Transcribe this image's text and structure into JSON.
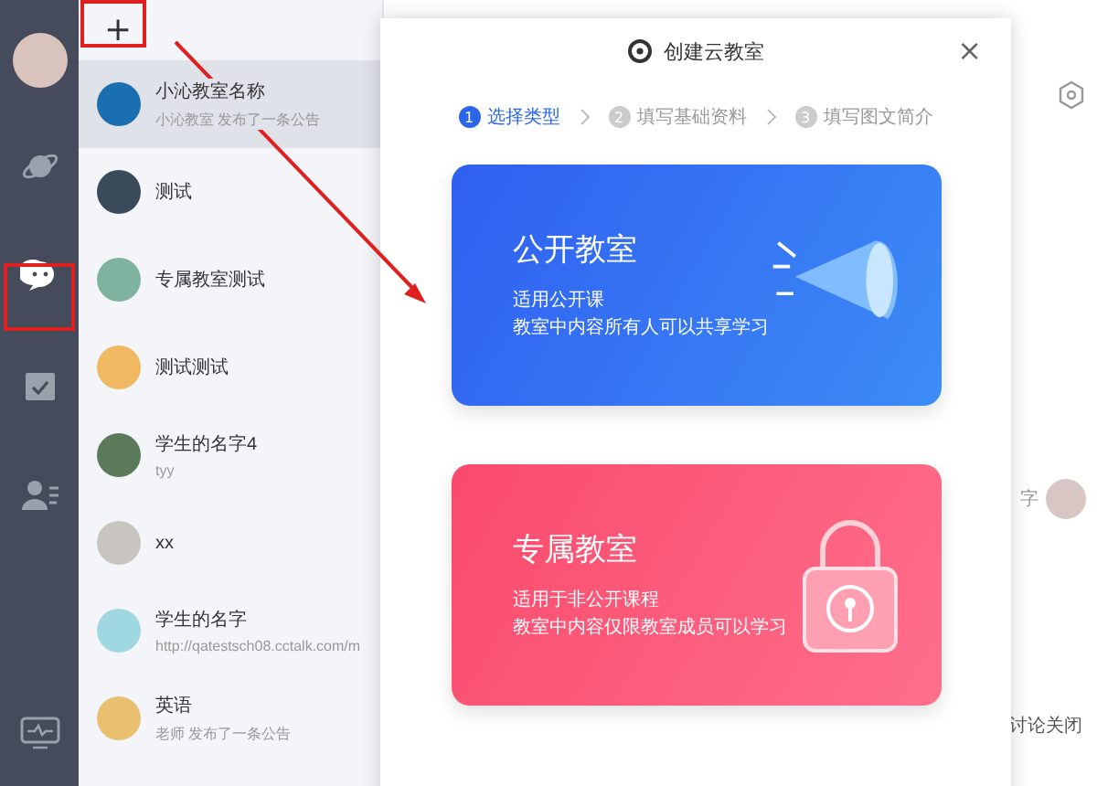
{
  "rail": {
    "items": [
      {
        "kind": "planet",
        "selected": false
      },
      {
        "kind": "chat",
        "selected": true
      },
      {
        "kind": "calendar",
        "selected": false
      },
      {
        "kind": "contacts",
        "selected": false
      }
    ]
  },
  "list": {
    "add_button": "+",
    "items": [
      {
        "name": "小沁教室名称",
        "preview": "小沁教室 发布了一条公告",
        "selected": true,
        "color": "#1a6fb0"
      },
      {
        "name": "测试",
        "selected": false,
        "color": "#3a4a5a"
      },
      {
        "name": "专属教室测试",
        "selected": false,
        "color": "#7fb3a0"
      },
      {
        "name": "测试测试",
        "selected": false,
        "color": "#f0b860"
      },
      {
        "name": "学生的名字4",
        "preview": "tyy",
        "selected": false,
        "color": "#5a7a5a"
      },
      {
        "name": "xx",
        "selected": false,
        "color": "#c8c4c0"
      },
      {
        "name": "学生的名字",
        "preview": "http://qatestsch08.cctalk.com/m",
        "selected": false,
        "color": "#9fd8e0"
      },
      {
        "name": "英语",
        "preview": "老师 发布了一条公告",
        "selected": false,
        "color": "#e8c070"
      }
    ]
  },
  "background": {
    "partial_label": "字",
    "footer_text": "讨论关闭"
  },
  "dialog": {
    "title": "创建云教室",
    "close": "×",
    "steps": [
      {
        "number": "1",
        "label": "选择类型",
        "selected": true
      },
      {
        "number": "2",
        "label": "填写基础资料",
        "selected": false
      },
      {
        "number": "3",
        "label": "填写图文简介",
        "selected": false
      }
    ],
    "cards": [
      {
        "kind": "public",
        "title": "公开教室",
        "lines": [
          "适用公开课",
          "教室中内容所有人可以共享学习"
        ]
      },
      {
        "kind": "private",
        "title": "专属教室",
        "lines": [
          "适用于非公开课程",
          "教室中内容仅限教室成员可以学习"
        ]
      }
    ]
  }
}
